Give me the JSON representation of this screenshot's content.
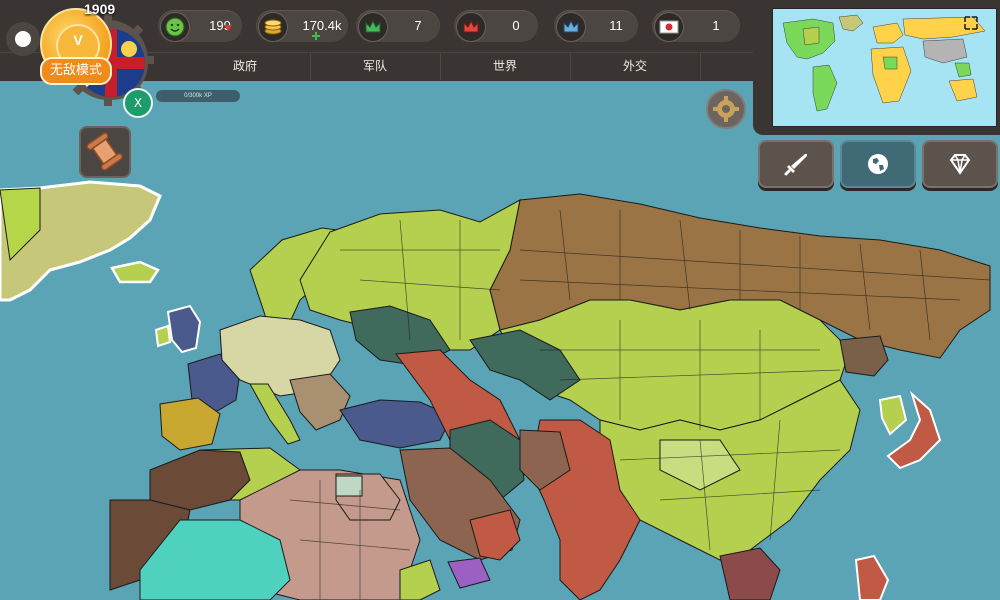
{
  "game": {
    "year": "1909",
    "mode_badge": "无敌模式",
    "close_label": "X",
    "xp_label": "0/300k XP"
  },
  "resources": [
    {
      "id": "happiness",
      "icon": "smiley-icon",
      "value": "199",
      "trend": "down"
    },
    {
      "id": "gold",
      "icon": "gold-coins-icon",
      "value": "170.4k",
      "trend": "up"
    },
    {
      "id": "allies",
      "icon": "green-crown-icon",
      "value": "7"
    },
    {
      "id": "enemies",
      "icon": "red-crown-icon",
      "value": "0"
    },
    {
      "id": "kings",
      "icon": "blue-crown-icon",
      "value": "11"
    },
    {
      "id": "japan",
      "icon": "japan-flag-icon",
      "value": "1"
    }
  ],
  "tabs": [
    {
      "label": "政府"
    },
    {
      "label": "军队"
    },
    {
      "label": "世界"
    },
    {
      "label": "外交"
    }
  ],
  "side_buttons": [
    {
      "icon": "sword-icon"
    },
    {
      "icon": "globe-icon",
      "active": true
    },
    {
      "icon": "diamond-icon"
    }
  ],
  "colors": {
    "ocean": "#5aa4b6",
    "lime": "#b4d04e",
    "russia_brown": "#9a7444",
    "red": "#c05a45",
    "navy": "#4b5a8c",
    "teal_green": "#3f6a5c",
    "sand": "#c49a8c",
    "aqua": "#4fd1bf",
    "purple": "#9c5fc2",
    "dark_brown": "#6b4a37"
  }
}
